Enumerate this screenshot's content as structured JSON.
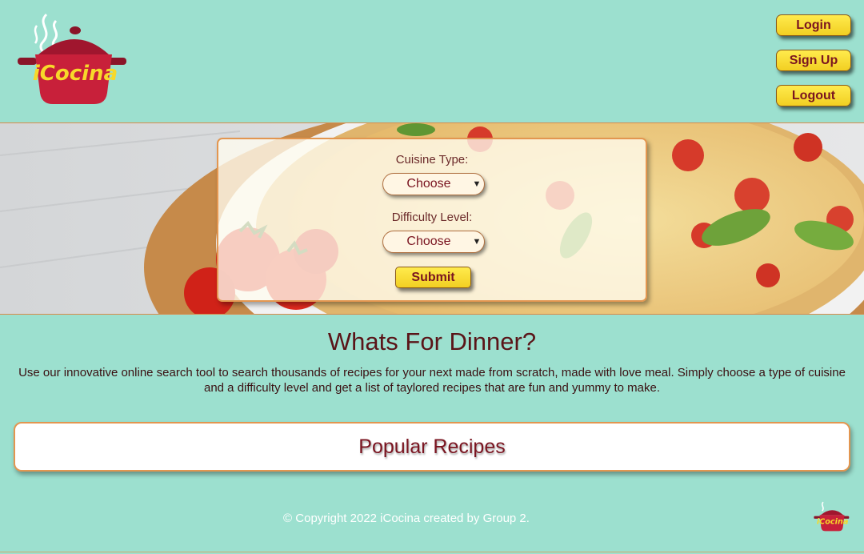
{
  "header": {
    "logo_text": "iCocina",
    "login_label": "Login",
    "signup_label": "Sign Up",
    "logout_label": "Logout"
  },
  "search": {
    "cuisine_label": "Cuisine Type:",
    "cuisine_value": "Choose",
    "difficulty_label": "Difficulty Level:",
    "difficulty_value": "Choose",
    "submit_label": "Submit"
  },
  "intro": {
    "title": "Whats For Dinner?",
    "text": "Use our innovative online search tool to search thousands of recipes for your next made from scratch, made with love meal. Simply choose a type of cuisine and a difficulty level and get a list of taylored recipes that are fun and yummy to make."
  },
  "popular": {
    "title": "Popular Recipes"
  },
  "footer": {
    "copyright": "© Copyright 2022 iCocina created by Group 2.",
    "logo_text": "iCocina"
  },
  "icons": {
    "dropdown": "chevron-down-icon",
    "logo": "cooking-pot-logo"
  },
  "colors": {
    "background": "#9ce0cf",
    "button_yellow": "#f7dc2e",
    "brand_red": "#c8203a",
    "accent_orange": "#e39650"
  }
}
